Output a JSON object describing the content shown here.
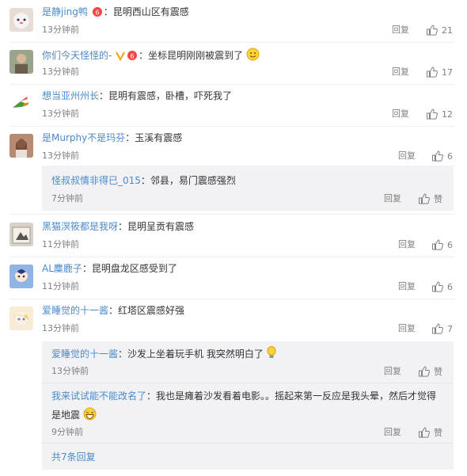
{
  "reply_label": "回复",
  "like_label": "赞",
  "comments": [
    {
      "user": "是静jing鸭",
      "text": "：昆明西山区有震感",
      "time": "13分钟前",
      "likes": "21"
    },
    {
      "user": "你们今天怪怪的-",
      "text": "：坐标昆明刚刚被震到了",
      "time": "13分钟前",
      "likes": "17"
    },
    {
      "user": "想当亚州州长",
      "text": "：昆明有震感，卧槽，吓死我了",
      "time": "13分钟前",
      "likes": "12"
    },
    {
      "user": "是Murphy不是玛芬",
      "text": "：玉溪有震感",
      "time": "13分钟前",
      "likes": "6",
      "sub": {
        "user": "怪叔叔情非得已_015",
        "text": "：邻县，易门震感强烈",
        "time": "7分钟前"
      }
    },
    {
      "user": "黑猫溟筱都是我呀",
      "text": "：昆明呈贡有震感",
      "time": "11分钟前",
      "likes": "6"
    },
    {
      "user": "AL麋鹿子",
      "text": "：昆明盘龙区感受到了",
      "time": "11分钟前",
      "likes": "6"
    },
    {
      "user": "爱睡觉的十一酱",
      "text": "：红塔区震感好强",
      "time": "13分钟前",
      "likes": "7",
      "subs": [
        {
          "user": "爱睡觉的十一酱",
          "text": "：沙发上坐着玩手机 我突然明白了",
          "time": "13分钟前"
        },
        {
          "user": "我来试试能不能改名了",
          "text": "：我也是瘫着沙发看着电影。。摇起来第一反应是我头晕，然后才觉得",
          "text2": "是地震",
          "time": "9分钟前"
        }
      ],
      "all_replies": "共7条回复"
    }
  ]
}
